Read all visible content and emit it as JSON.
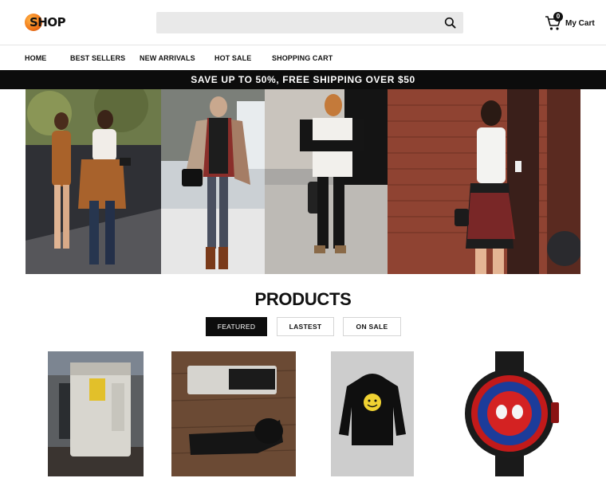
{
  "brand": {
    "logo_text": "SHOP"
  },
  "search": {
    "placeholder": ""
  },
  "cart": {
    "count": "0",
    "label": "My Cart"
  },
  "nav": {
    "items": [
      {
        "label": "HOME"
      },
      {
        "label": "BEST SELLERS"
      },
      {
        "label": "NEW ARRIVALS"
      },
      {
        "label": "HOT SALE"
      },
      {
        "label": "SHOPPING CART"
      }
    ]
  },
  "promo": {
    "text": "SAVE UP TO 50%, FREE SHIPPING OVER $50"
  },
  "hero": {
    "image": "street-style-fashion-collage"
  },
  "products": {
    "title": "PRODUCTS",
    "tabs": [
      {
        "label": "FEATURED",
        "active": true
      },
      {
        "label": "LASTEST",
        "active": false
      },
      {
        "label": "ON SALE",
        "active": false
      }
    ],
    "items": [
      {
        "image": "industrial-heater-box"
      },
      {
        "image": "fan-heater-on-floor"
      },
      {
        "image": "black-kids-hoodie-smiley"
      },
      {
        "image": "spiderman-watch"
      }
    ]
  },
  "colors": {
    "accent": "#f27a1a",
    "dark": "#0c0c0c",
    "search_bg": "#e9e9e9"
  }
}
